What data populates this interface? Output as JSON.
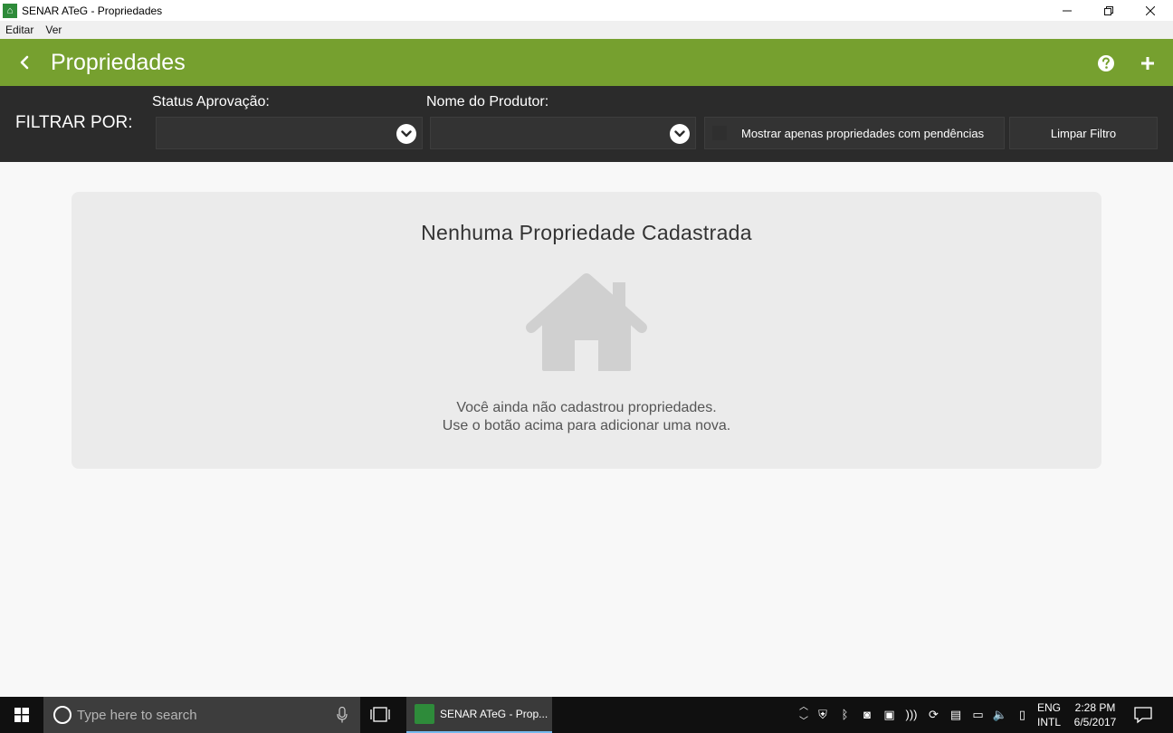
{
  "window": {
    "title": "SENAR ATeG - Propriedades",
    "app_icon": "senar-app-icon",
    "controls": [
      "minimize-icon",
      "restore-icon",
      "close-icon"
    ]
  },
  "menubar": {
    "items": [
      {
        "label": "Editar"
      },
      {
        "label": "Ver"
      }
    ]
  },
  "appbar": {
    "title": "Propriedades",
    "back_icon": "chevron-left-icon",
    "help_icon": "help-circle-icon",
    "add_icon": "plus-icon",
    "color": "#76a02f"
  },
  "filters": {
    "label": "FILTRAR POR:",
    "status_label": "Status Aprovação:",
    "status_value": "",
    "producer_label": "Nome do Produtor:",
    "producer_value": "",
    "pending_checkbox_label": "Mostrar apenas propriedades com pendências",
    "pending_checked": false,
    "clear_button": "Limpar Filtro"
  },
  "empty_state": {
    "title": "Nenhuma Propriedade Cadastrada",
    "icon": "house-icon",
    "line1": "Você ainda não cadastrou propriedades.",
    "line2": "Use o botão acima para adicionar uma nova."
  },
  "taskbar": {
    "search_placeholder": "Type here to search",
    "active_app_label": "SENAR ATeG - Prop...",
    "language_top": "ENG",
    "language_bottom": "INTL",
    "time": "2:28 PM",
    "date": "6/5/2017"
  }
}
